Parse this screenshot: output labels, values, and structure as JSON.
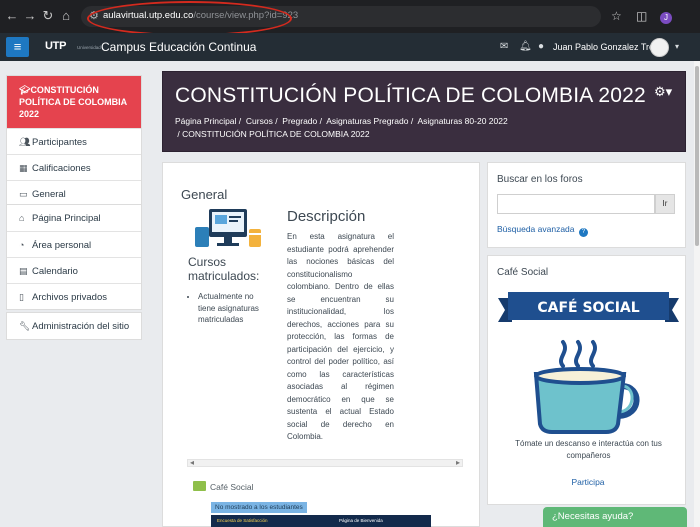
{
  "browser": {
    "url_host": "aulavirtual.utp.edu.co",
    "url_path": "/course/view.php?id=923",
    "profile_initial": "J"
  },
  "header": {
    "logo": "UTP",
    "logo_sub": "Universidad",
    "site_name": "Campus Educación Continua",
    "user_name": "Juan Pablo Gonzalez Trejo"
  },
  "sidebar": {
    "active_course": "CONSTITUCIÓN POLÍTICA DE COLOMBIA 2022",
    "course_items": [
      "Participantes",
      "Calificaciones",
      "General"
    ],
    "site_items": [
      "Página Principal",
      "Área personal",
      "Calendario",
      "Archivos privados"
    ],
    "admin_items": [
      "Administración del sitio"
    ]
  },
  "course": {
    "title": "CONSTITUCIÓN POLÍTICA DE COLOMBIA 2022",
    "breadcrumb": [
      "Página Principal",
      "Cursos",
      "Pregrado",
      "Asignaturas Pregrado",
      "Asignaturas 80-20 2022",
      "CONSTITUCIÓN POLÍTICA DE COLOMBIA 2022"
    ]
  },
  "main": {
    "section_title": "General",
    "description_title": "Descripción",
    "description_text": "En esta asignatura el estudiante podrá aprehender las nociones básicas del constitucionalismo colombiano. Dentro de ellas se encuentran su institucionalidad, los derechos, acciones para su protección, las formas de participación del ejercicio, y control del poder político, así como las características asociadas al régimen democrático en que se sustenta el actual Estado social de derecho en Colombia.",
    "cursos_title": "Cursos matriculados:",
    "cursos_items": [
      "Actualmente no tiene asignaturas matriculadas"
    ],
    "forum_link": "Café Social",
    "hidden_badge": "No mostrado a los estudiantes",
    "image_text_left": "Encuesta de Satisfacción",
    "image_text_right": "Página de Bienvenida"
  },
  "blocks": {
    "search": {
      "title": "Buscar en los foros",
      "button": "Ir",
      "advanced": "Búsqueda avanzada",
      "help": "?"
    },
    "cafe": {
      "title": "Café Social",
      "banner": "CAFÉ SOCIAL",
      "text": "Tómate un descanso e interactúa con tus compañeros",
      "link": "Participa"
    }
  },
  "help_chat": "¿Necesitas ayuda?",
  "colors": {
    "banner_bg": "#3a2e3f",
    "active_nav": "#e5434e",
    "header_bg": "#242d35",
    "link": "#1e5fa5",
    "cafe_blue": "#1f4f8f",
    "mug_teal": "#6ec2cc",
    "help_green": "#5fb877"
  }
}
